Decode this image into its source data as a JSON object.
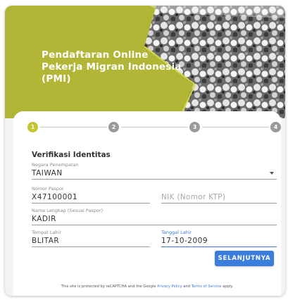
{
  "hero": {
    "title_line1": "Pendaftaran Online",
    "title_line2": "Pekerja Migran Indonesia",
    "title_line3": "(PMI)",
    "accent_color": "#b2b637"
  },
  "stepper": {
    "steps": [
      "1",
      "2",
      "3",
      "4"
    ],
    "active_step": 1,
    "active_color": "#c3c62f",
    "inactive_color": "#9a9a9a"
  },
  "form": {
    "section_title": "Verifikasi Identitas",
    "negara": {
      "label": "Negara Penempatan",
      "value": "TAIWAN"
    },
    "paspor": {
      "label": "Nomor Paspor",
      "value": "X47100001"
    },
    "nik": {
      "placeholder": "NIK (Nomor KTP)"
    },
    "nama": {
      "label": "Nama Lengkap (Sesuai Paspor)",
      "value": "KADIR"
    },
    "tempat_lahir": {
      "label": "Tempat Lahir",
      "value": "BLITAR"
    },
    "tanggal_lahir": {
      "label": "Tanggal Lahir",
      "value": "17-10-2009"
    },
    "next_label": "SELANJUTNYA",
    "primary_color": "#3b7ddd"
  },
  "footer": {
    "prefix": "This site is protected by reCAPTCHA and the Google",
    "privacy": "Privacy Policy",
    "and": "and",
    "terms": "Terms of Service",
    "suffix": "apply."
  }
}
